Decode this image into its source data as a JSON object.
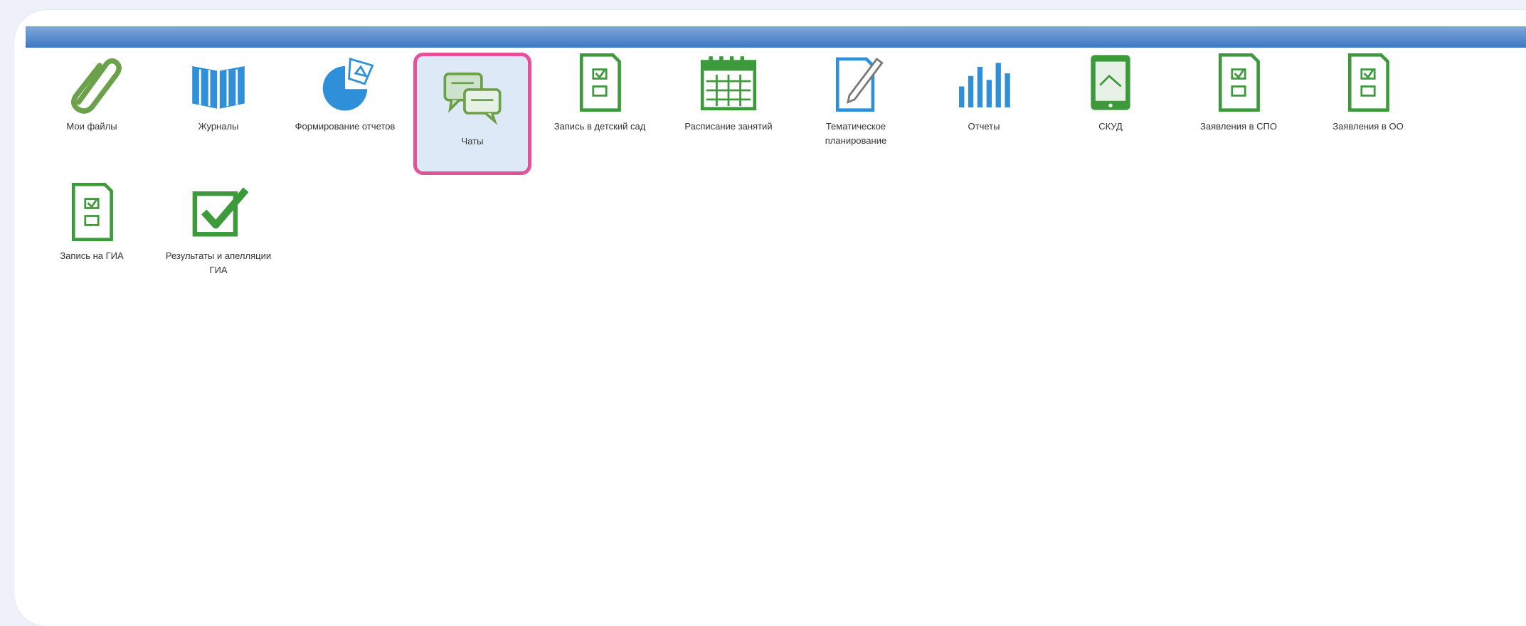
{
  "top_bar": {
    "left_text": "",
    "right_text": ""
  },
  "tiles": [
    {
      "label": "Мои файлы",
      "icon": "paperclip-icon"
    },
    {
      "label": "Журналы",
      "icon": "book-icon"
    },
    {
      "label": "Формирование отчетов",
      "icon": "pie-chart-icon"
    },
    {
      "label": "Чаты",
      "icon": "chat-icon",
      "selected": true
    },
    {
      "label": "Запись в детский сад",
      "icon": "form-document-icon"
    },
    {
      "label": "Расписание занятий",
      "icon": "calendar-icon"
    },
    {
      "label": "Тематическое планирование",
      "icon": "document-pen-icon"
    },
    {
      "label": "Отчеты",
      "icon": "bar-chart-icon"
    },
    {
      "label": "СКУД",
      "icon": "tablet-icon"
    },
    {
      "label": "Заявления в СПО",
      "icon": "form-document-icon"
    },
    {
      "label": "Заявления в ОО",
      "icon": "form-document-icon"
    },
    {
      "label": "Запись на ГИА",
      "icon": "form-document-icon"
    },
    {
      "label": "Результаты и апелляции ГИА",
      "icon": "checkmark-box-icon"
    }
  ],
  "colors": {
    "highlight_border": "#e4519a",
    "green": "#3c9a3a",
    "blue": "#2f8fd8"
  }
}
